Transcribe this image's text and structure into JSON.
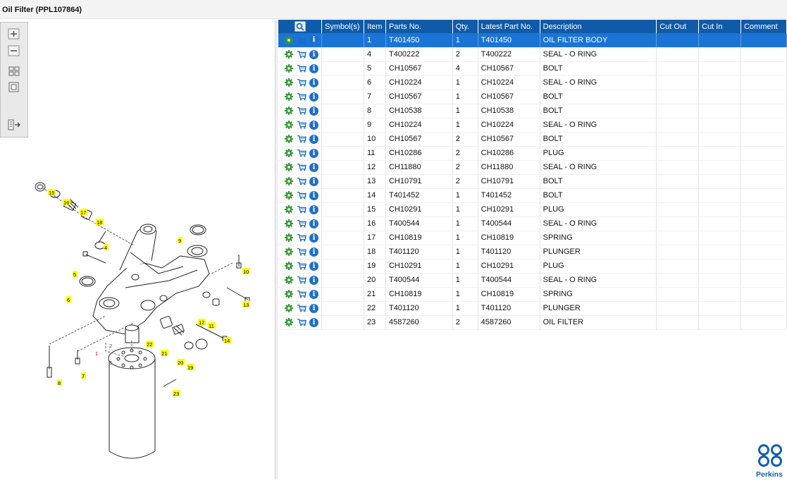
{
  "window": {
    "title": "Oil Filter (PPL107864)"
  },
  "toolbar": {
    "buttons": [
      {
        "name": "zoom-in-button",
        "icon": "zoom-in-icon"
      },
      {
        "name": "zoom-out-button",
        "icon": "zoom-out-icon"
      },
      {
        "name": "fit-all-button",
        "icon": "fit-all-icon"
      },
      {
        "name": "fit-window-button",
        "icon": "fit-window-icon"
      },
      {
        "name": "export-button",
        "icon": "export-icon"
      }
    ]
  },
  "diagram": {
    "callouts": [
      "15",
      "16",
      "17",
      "18",
      "4",
      "9",
      "5",
      "10",
      "6",
      "13",
      "12",
      "11",
      "22",
      "21",
      "14",
      "20",
      "19",
      "1",
      "2",
      "3",
      "8",
      "7",
      "23"
    ]
  },
  "grid": {
    "columns": [
      "",
      "Symbol(s)",
      "Item",
      "Parts No.",
      "Qty.",
      "Latest Part No.",
      "Description",
      "Cut Out",
      "Cut In",
      "Comment"
    ],
    "selected_index": 0,
    "rows": [
      {
        "item": "1",
        "part": "T401450",
        "qty": "1",
        "latest": "T401450",
        "desc": "OIL FILTER BODY"
      },
      {
        "item": "4",
        "part": "T400222",
        "qty": "2",
        "latest": "T400222",
        "desc": "SEAL - O RING"
      },
      {
        "item": "5",
        "part": "CH10567",
        "qty": "4",
        "latest": "CH10567",
        "desc": "BOLT"
      },
      {
        "item": "6",
        "part": "CH10224",
        "qty": "1",
        "latest": "CH10224",
        "desc": "SEAL - O RING"
      },
      {
        "item": "7",
        "part": "CH10567",
        "qty": "1",
        "latest": "CH10567",
        "desc": "BOLT"
      },
      {
        "item": "8",
        "part": "CH10538",
        "qty": "1",
        "latest": "CH10538",
        "desc": "BOLT"
      },
      {
        "item": "9",
        "part": "CH10224",
        "qty": "1",
        "latest": "CH10224",
        "desc": "SEAL - O RING"
      },
      {
        "item": "10",
        "part": "CH10567",
        "qty": "2",
        "latest": "CH10567",
        "desc": "BOLT"
      },
      {
        "item": "11",
        "part": "CH10286",
        "qty": "2",
        "latest": "CH10286",
        "desc": "PLUG"
      },
      {
        "item": "12",
        "part": "CH11880",
        "qty": "2",
        "latest": "CH11880",
        "desc": "SEAL - O RING"
      },
      {
        "item": "13",
        "part": "CH10791",
        "qty": "2",
        "latest": "CH10791",
        "desc": "BOLT"
      },
      {
        "item": "14",
        "part": "T401452",
        "qty": "1",
        "latest": "T401452",
        "desc": "BOLT"
      },
      {
        "item": "15",
        "part": "CH10291",
        "qty": "1",
        "latest": "CH10291",
        "desc": "PLUG"
      },
      {
        "item": "16",
        "part": "T400544",
        "qty": "1",
        "latest": "T400544",
        "desc": "SEAL - O RING"
      },
      {
        "item": "17",
        "part": "CH10819",
        "qty": "1",
        "latest": "CH10819",
        "desc": "SPRING"
      },
      {
        "item": "18",
        "part": "T401120",
        "qty": "1",
        "latest": "T401120",
        "desc": "PLUNGER"
      },
      {
        "item": "19",
        "part": "CH10291",
        "qty": "1",
        "latest": "CH10291",
        "desc": "PLUG"
      },
      {
        "item": "20",
        "part": "T400544",
        "qty": "1",
        "latest": "T400544",
        "desc": "SEAL - O RING"
      },
      {
        "item": "21",
        "part": "CH10819",
        "qty": "1",
        "latest": "CH10819",
        "desc": "SPRING"
      },
      {
        "item": "22",
        "part": "T401120",
        "qty": "1",
        "latest": "T401120",
        "desc": "PLUNGER"
      },
      {
        "item": "23",
        "part": "4587260",
        "qty": "2",
        "latest": "4587260",
        "desc": "OIL FILTER"
      }
    ],
    "row_icons": [
      "gear-icon",
      "cart-icon",
      "info-icon"
    ]
  },
  "brand": {
    "name": "Perkins",
    "color": "#1460aa"
  },
  "colors": {
    "header": "#0f5ba9",
    "selected_row": "#1a74d6",
    "callout": "#ffff00"
  }
}
